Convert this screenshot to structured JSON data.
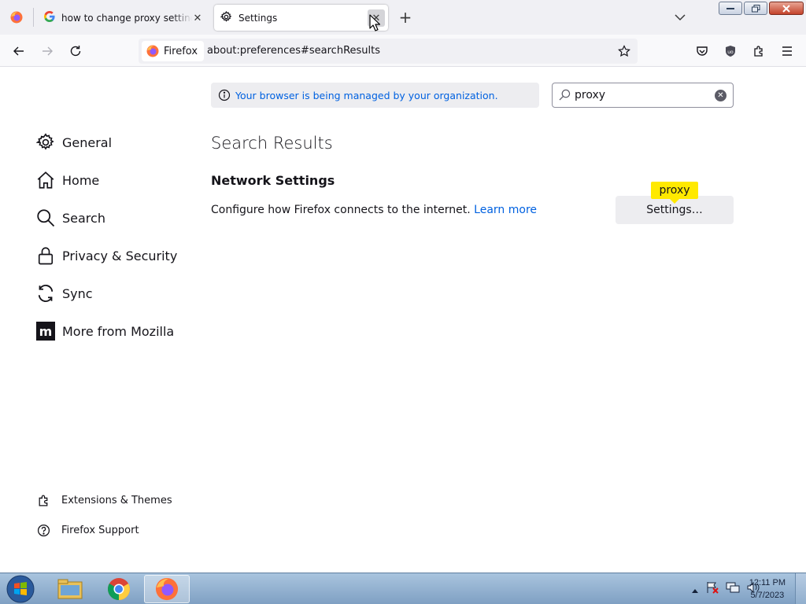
{
  "tabs": [
    {
      "title": "how to change proxy setting with",
      "favicon": "google-icon"
    },
    {
      "title": "Settings",
      "favicon": "gear-icon",
      "active": true
    }
  ],
  "nav": {
    "identity_label": "Firefox",
    "url": "about:preferences#searchResults"
  },
  "sidebar": {
    "categories": [
      {
        "label": "General",
        "icon": "gear-icon"
      },
      {
        "label": "Home",
        "icon": "home-icon"
      },
      {
        "label": "Search",
        "icon": "search-icon"
      },
      {
        "label": "Privacy & Security",
        "icon": "lock-icon"
      },
      {
        "label": "Sync",
        "icon": "sync-icon"
      },
      {
        "label": "More from Mozilla",
        "icon": "mozilla-icon"
      }
    ],
    "footer": [
      {
        "label": "Extensions & Themes",
        "icon": "puzzle-icon"
      },
      {
        "label": "Firefox Support",
        "icon": "help-icon"
      }
    ]
  },
  "main": {
    "policies_notice": "Your browser is being managed by your organization.",
    "search_value": "proxy",
    "results_title": "Search Results",
    "network_heading": "Network Settings",
    "network_desc": "Configure how Firefox connects to the internet.",
    "learn_more": "Learn more",
    "settings_button": "Settings…",
    "highlight_tip": "proxy"
  },
  "taskbar": {
    "time": "12:11 PM",
    "date": "5/7/2023"
  },
  "colors": {
    "accent": "#0061e0",
    "highlight": "#ffe900",
    "firefox_orange": "#ff7139"
  }
}
